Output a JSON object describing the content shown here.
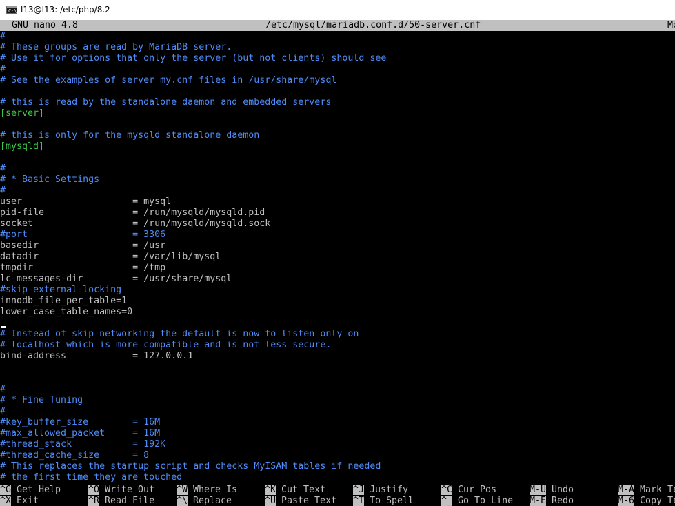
{
  "window": {
    "title": "l13@l13: /etc/php/8.2"
  },
  "header": {
    "version": "GNU nano 4.8",
    "filename": "/etc/mysql/mariadb.conf.d/50-server.cnf",
    "modified": "Mo"
  },
  "lines": [
    {
      "type": "comment",
      "text": "#"
    },
    {
      "type": "comment",
      "text": "# These groups are read by MariaDB server."
    },
    {
      "type": "comment",
      "text": "# Use it for options that only the server (but not clients) should see"
    },
    {
      "type": "comment",
      "text": "#"
    },
    {
      "type": "comment",
      "text": "# See the examples of server my.cnf files in /usr/share/mysql"
    },
    {
      "type": "blank",
      "text": ""
    },
    {
      "type": "comment",
      "text": "# this is read by the standalone daemon and embedded servers"
    },
    {
      "type": "section",
      "text": "[server]"
    },
    {
      "type": "blank",
      "text": ""
    },
    {
      "type": "comment",
      "text": "# this is only for the mysqld standalone daemon"
    },
    {
      "type": "section",
      "text": "[mysqld]"
    },
    {
      "type": "blank",
      "text": ""
    },
    {
      "type": "comment",
      "text": "#"
    },
    {
      "type": "comment",
      "text": "# * Basic Settings"
    },
    {
      "type": "comment",
      "text": "#"
    },
    {
      "type": "setting",
      "key": "user                    ",
      "sep": "= ",
      "value": "mysql"
    },
    {
      "type": "setting",
      "key": "pid-file                ",
      "sep": "= ",
      "value": "/run/mysqld/mysqld.pid"
    },
    {
      "type": "setting",
      "key": "socket                  ",
      "sep": "= ",
      "value": "/run/mysqld/mysqld.sock"
    },
    {
      "type": "comment",
      "text": "#port                   = 3306"
    },
    {
      "type": "setting",
      "key": "basedir                 ",
      "sep": "= ",
      "value": "/usr"
    },
    {
      "type": "setting",
      "key": "datadir                 ",
      "sep": "= ",
      "value": "/var/lib/mysql"
    },
    {
      "type": "setting",
      "key": "tmpdir                  ",
      "sep": "= ",
      "value": "/tmp"
    },
    {
      "type": "setting",
      "key": "lc-messages-dir         ",
      "sep": "= ",
      "value": "/usr/share/mysql"
    },
    {
      "type": "comment",
      "text": "#skip-external-locking"
    },
    {
      "type": "plain",
      "text": "innodb_file_per_table=1"
    },
    {
      "type": "plain",
      "text": "lower_case_table_names=0"
    },
    {
      "type": "blank",
      "text": ""
    },
    {
      "type": "comment",
      "text": "# Instead of skip-networking the default is now to listen only on"
    },
    {
      "type": "comment",
      "text": "# localhost which is more compatible and is not less secure."
    },
    {
      "type": "setting",
      "key": "bind-address            ",
      "sep": "= ",
      "value": "127.0.0.1"
    },
    {
      "type": "blank",
      "text": ""
    },
    {
      "type": "blank",
      "text": ""
    },
    {
      "type": "comment",
      "text": "#"
    },
    {
      "type": "comment",
      "text": "# * Fine Tuning"
    },
    {
      "type": "comment",
      "text": "#"
    },
    {
      "type": "comment",
      "text": "#key_buffer_size        = 16M"
    },
    {
      "type": "comment",
      "text": "#max_allowed_packet     = 16M"
    },
    {
      "type": "comment",
      "text": "#thread_stack           = 192K"
    },
    {
      "type": "comment",
      "text": "#thread_cache_size      = 8"
    },
    {
      "type": "comment",
      "text": "# This replaces the startup script and checks MyISAM tables if needed"
    },
    {
      "type": "comment",
      "text": "# the first time they are touched"
    }
  ],
  "shortcuts_row1": [
    {
      "key": "^G",
      "label": " Get Help"
    },
    {
      "key": "^O",
      "label": " Write Out"
    },
    {
      "key": "^W",
      "label": " Where Is"
    },
    {
      "key": "^K",
      "label": " Cut Text"
    },
    {
      "key": "^J",
      "label": " Justify"
    },
    {
      "key": "^C",
      "label": " Cur Pos"
    },
    {
      "key": "M-U",
      "label": " Undo"
    },
    {
      "key": "M-A",
      "label": " Mark Te"
    }
  ],
  "shortcuts_row2": [
    {
      "key": "^X",
      "label": " Exit"
    },
    {
      "key": "^R",
      "label": " Read File"
    },
    {
      "key": "^\\",
      "label": " Replace"
    },
    {
      "key": "^U",
      "label": " Paste Text"
    },
    {
      "key": "^T",
      "label": " To Spell"
    },
    {
      "key": "^_",
      "label": " Go To Line"
    },
    {
      "key": "M-E",
      "label": " Redo"
    },
    {
      "key": "M-6",
      "label": " Copy Te"
    }
  ],
  "colors": {
    "comment": "#4f8cf7",
    "section": "#3cc84a",
    "plain": "#c0c0c0",
    "background": "#000000",
    "bar": "#c0c0c0"
  }
}
